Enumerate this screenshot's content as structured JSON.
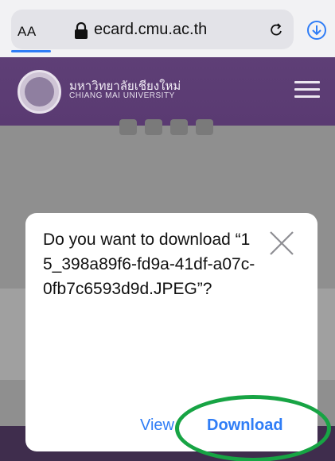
{
  "browser": {
    "text_size_button": "AA",
    "url": "ecard.cmu.ac.th"
  },
  "header": {
    "university_thai": "มหาวิทยาลัยเชียงใหม่",
    "university_english": "CHIANG MAI UNIVERSITY"
  },
  "dialog": {
    "message": "Do you want to download “15_398a89f6-fd9a-41df-a07c-0fb7c6593d9d.JPEG”?",
    "view_label": "View",
    "download_label": "Download"
  },
  "colors": {
    "accent": "#2f7df6",
    "header_purple": "#5a3a72",
    "highlight_green": "#17a444"
  }
}
